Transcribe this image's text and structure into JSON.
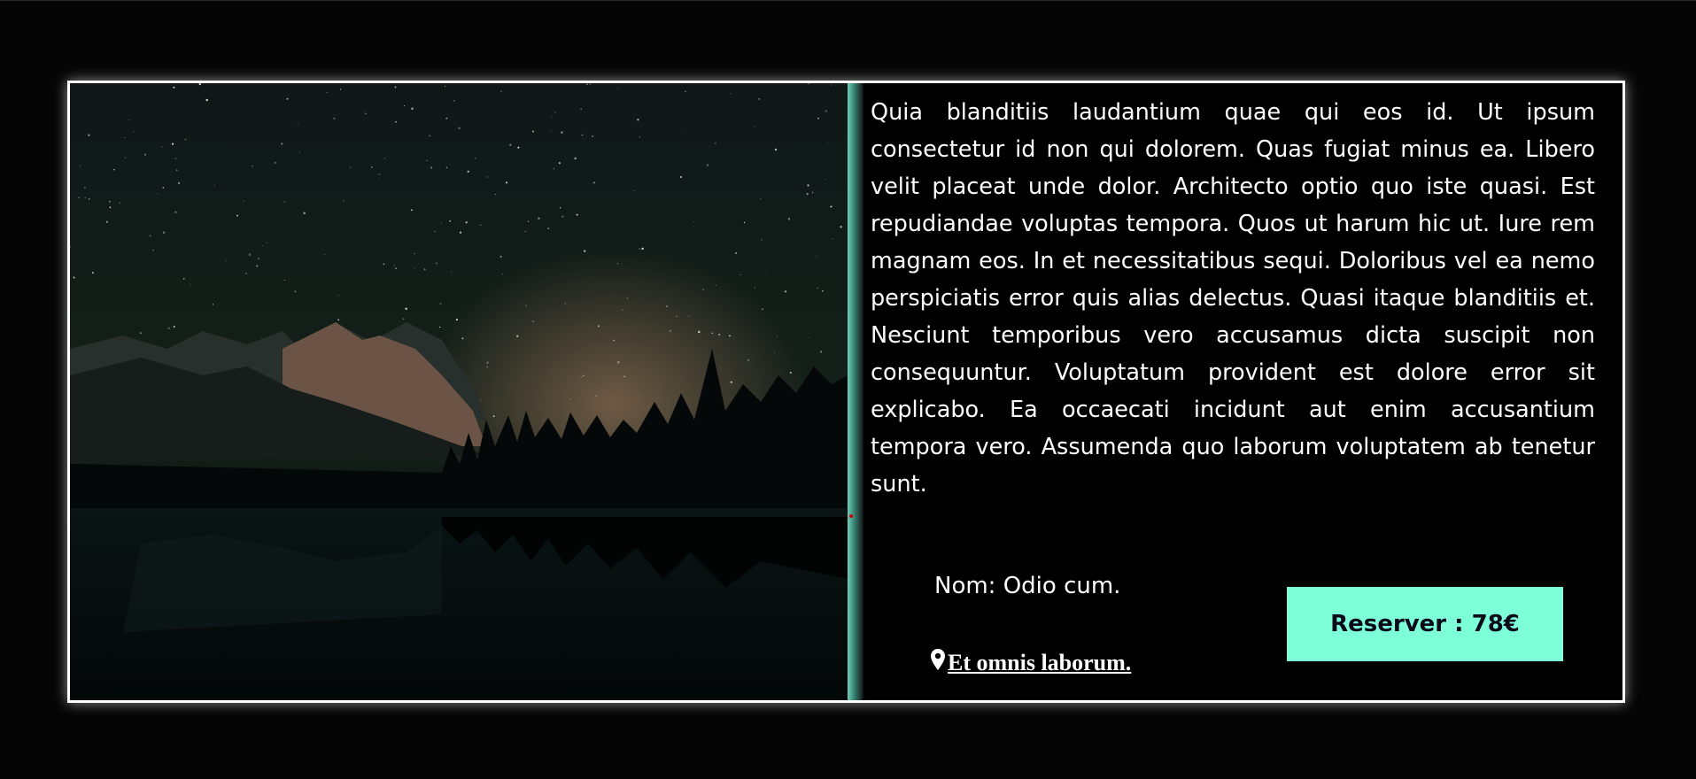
{
  "card": {
    "description": "Quia blanditiis laudantium quae qui eos id. Ut ipsum consectetur id non qui dolorem. Quas fugiat minus ea. Libero velit placeat unde dolor. Architecto optio quo iste quasi. Est repudiandae voluptas tempora. Quos ut harum hic ut. Iure rem magnam eos. In et necessitatibus sequi. Doloribus vel ea nemo perspiciatis error quis alias delectus. Quasi itaque blanditiis et. Nesciunt temporibus vero accusamus dicta suscipit non consequuntur. Voluptatum provident est dolore error sit explicabo. Ea occaecati incidunt aut enim accusantium tempora vero. Assumenda quo laborum voluptatem ab tenetur sunt.",
    "name_line": "Nom: Odio cum.",
    "location": "Et omnis laborum.",
    "location_icon": "map-pin-icon",
    "reserve_label": "Reserver : 78€",
    "image_icon": "night-mountain-lake-photo"
  },
  "colors": {
    "background": "#050505",
    "card_border": "#ffffff",
    "accent": "#7dffd8",
    "button_text": "#0a0a1a",
    "text": "#ffffff"
  }
}
